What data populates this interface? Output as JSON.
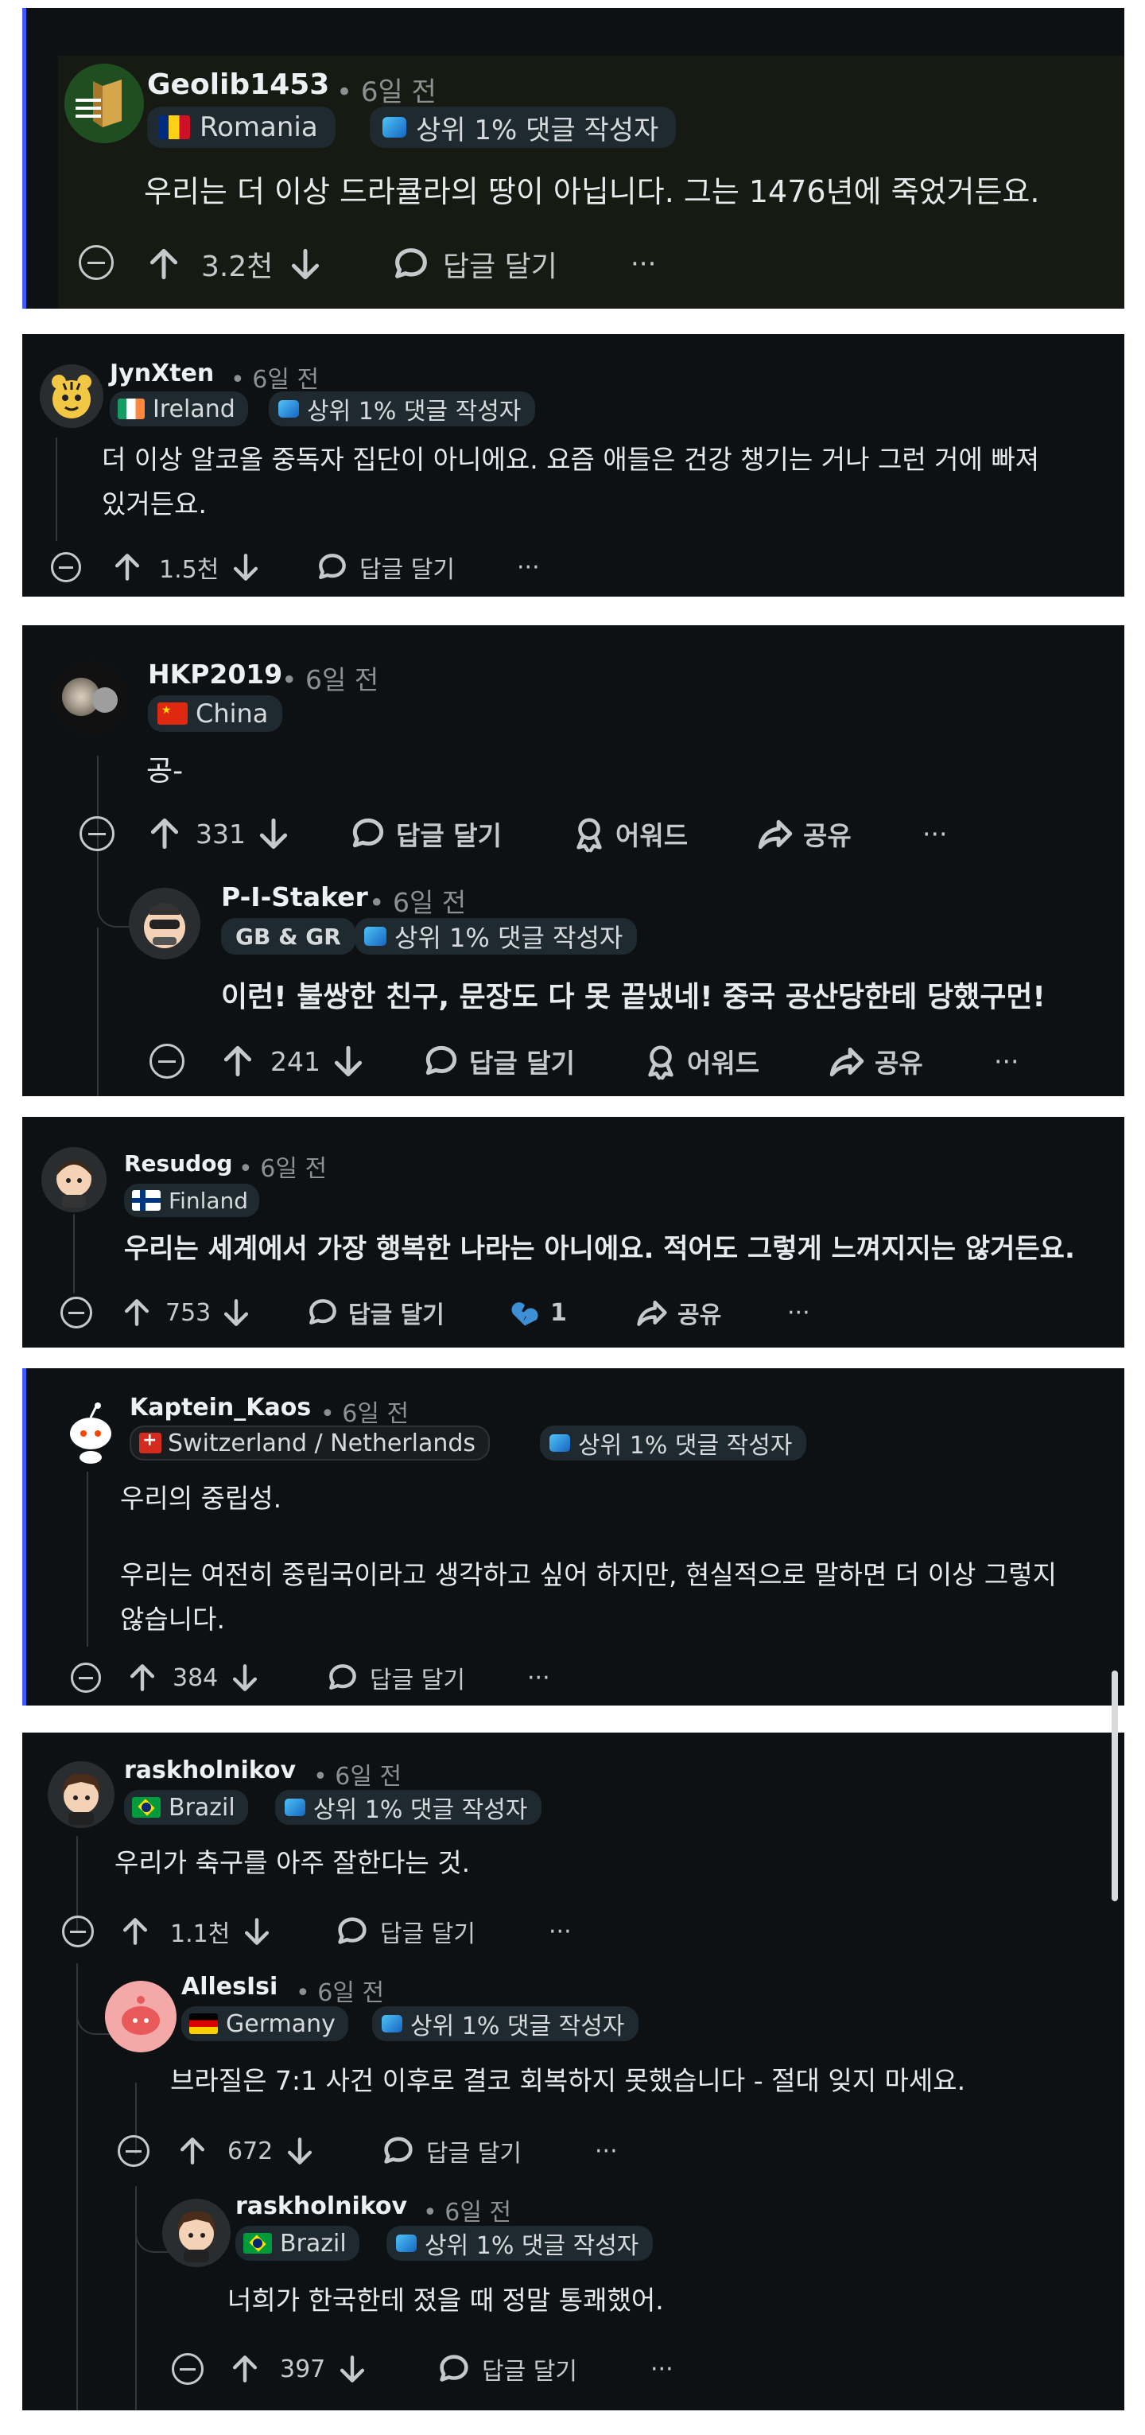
{
  "meta": {
    "time_ago": "6일 전",
    "separator": "•",
    "top1_badge": "상위 1% 댓글 작성자",
    "reply": "답글 달기",
    "award": "어워드",
    "share": "공유",
    "more": "···"
  },
  "comments": [
    {
      "user": "Geolib1453",
      "flag_label": "Romania",
      "body": "우리는 더 이상 드라큘라의 땅이 아닙니다. 그는 1476년에 죽었거든요.",
      "votes": "3.2천"
    },
    {
      "user": "JynXten",
      "flag_label": "Ireland",
      "body_line1": "더 이상 알코올 중독자 집단이 아니에요. 요즘 애들은 건강 챙기는 거나 그런 거에 빠져",
      "body_line2": "있거든요.",
      "votes": "1.5천"
    },
    {
      "user": "HKP2019",
      "flag_label": "China",
      "body": "공-",
      "votes": "331"
    },
    {
      "user": "P-I-Staker",
      "flag_label": "GB & GR",
      "body": "이런! 불쌍한 친구, 문장도 다 못 끝냈네! 중국 공산당한테 당했구먼!",
      "votes": "241"
    },
    {
      "user": "Resudog",
      "flag_label": "Finland",
      "body": "우리는 세계에서 가장 행복한 나라는 아니에요. 적어도 그렇게 느껴지지는 않거든요.",
      "votes": "753",
      "heart_count": "1"
    },
    {
      "user": "Kaptein_Kaos",
      "flag_label": "Switzerland / Netherlands",
      "body_line1": "우리의 중립성.",
      "body_line2": "우리는 여전히 중립국이라고 생각하고 싶어 하지만, 현실적으로 말하면 더 이상 그렇지",
      "body_line3": "않습니다.",
      "votes": "384"
    },
    {
      "user": "raskholnikov",
      "flag_label": "Brazil",
      "body": "우리가 축구를 아주 잘한다는 것.",
      "votes": "1.1천"
    },
    {
      "user": "AllesIsi",
      "flag_label": "Germany",
      "body": "브라질은 7:1 사건 이후로 결코 회복하지 못했습니다 - 절대 잊지 마세요.",
      "votes": "672"
    },
    {
      "user": "raskholnikov",
      "flag_label": "Brazil",
      "body": "너희가 한국한테 졌을 때 정말 통쾌했어.",
      "votes": "397"
    }
  ],
  "colors": {
    "card_bg": "#0e1113",
    "highlight_bar": "#3d5afe",
    "pill_bg": "#1f2a30",
    "text": "#d7dadc",
    "muted": "#8b9093"
  }
}
